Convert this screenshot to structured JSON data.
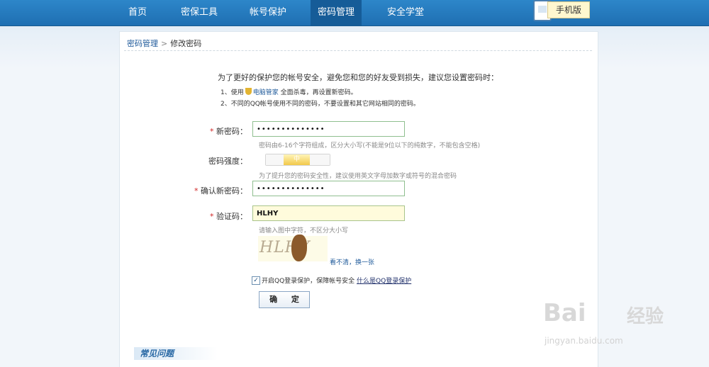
{
  "nav": {
    "items": [
      "首页",
      "密保工具",
      "帐号保护",
      "密码管理",
      "安全学堂"
    ],
    "active": "密码管理",
    "mobile_badge": "手机版"
  },
  "breadcrumb": {
    "parent": "密码管理",
    "separator": ">",
    "current": "修改密码"
  },
  "intro": "为了更好的保护您的帐号安全，避免您和您的好友受到损失，建议您设置密码时：",
  "tips": {
    "tip1_prefix": "1、使用",
    "tip1_link": "电脑管家",
    "tip1_suffix": "全面杀毒，再设置新密码。",
    "tip2": "2、不同的QQ帐号使用不同的密码，不要设置和其它网站相同的密码。"
  },
  "form": {
    "required_mark": "*",
    "new_password_label": "新密码：",
    "new_password_value": "••••••••••••••",
    "new_password_hint": "密码由6-16个字符组成，区分大小写(不能是9位以下的纯数字，不能包含空格)",
    "strength_label": "密码强度：",
    "strength_value": "中",
    "strength_hint": "为了提升您的密码安全性，建议使用英文字母加数字或符号的混合密码",
    "confirm_label": "确认新密码：",
    "confirm_value": "••••••••••••••",
    "captcha_label": "验证码：",
    "captcha_value": "HLHY",
    "captcha_hint": "请输入图中字符，不区分大小写",
    "captcha_image_text": "HLHY",
    "refresh_link": "看不清，换一张",
    "protect_label": "开启QQ登录保护，保障帐号安全",
    "protect_help_link": "什么是QQ登录保护",
    "protect_checked": true,
    "submit_label": "确 定"
  },
  "faq": {
    "title": "常见问题"
  },
  "watermark": {
    "brand": "Bai",
    "brand_suffix": "经验",
    "domain": "jingyan.baidu.com"
  },
  "colors": {
    "nav_bg": "#2d86c9",
    "nav_active": "#165c98",
    "link": "#1f5a9a",
    "required": "#d02525"
  }
}
